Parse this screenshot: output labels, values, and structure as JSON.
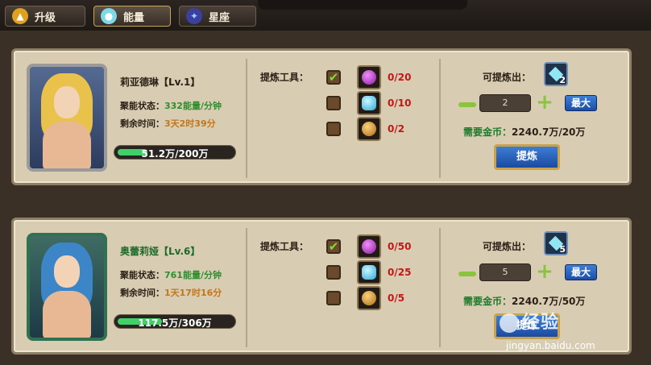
{
  "tabs": [
    {
      "label": "升级",
      "icon": "up-arrow-icon"
    },
    {
      "label": "能量",
      "icon": "potion-icon"
    },
    {
      "label": "星座",
      "icon": "constellation-icon"
    }
  ],
  "heroes": [
    {
      "name": "莉亚德琳【Lv.1】",
      "state_label": "聚能状态：",
      "state_value": "332能量/分钟",
      "time_label": "剩余时间：",
      "time_value": "3天2时39分",
      "exp_text": "51.2万/200万",
      "exp_fraction": 0.256,
      "tool_label": "提炼工具：",
      "tools": [
        {
          "checked": true,
          "count": "0/20",
          "icon": "purple-orb-icon"
        },
        {
          "checked": false,
          "count": "0/10",
          "icon": "blue-crystal-icon"
        },
        {
          "checked": false,
          "count": "0/2",
          "icon": "gold-urn-icon"
        }
      ],
      "refine_label": "可提炼出：",
      "refine_gem_count": "2",
      "stepper_value": "2",
      "max_label": "最大",
      "gold_label": "需要金币：",
      "gold_value": "2240.7万/20万",
      "refine_button": "提炼"
    },
    {
      "name": "奥蕾莉娅【Lv.6】",
      "state_label": "聚能状态：",
      "state_value": "761能量/分钟",
      "time_label": "剩余时间：",
      "time_value": "1天17时16分",
      "exp_text": "117.5万/306万",
      "exp_fraction": 0.384,
      "tool_label": "提炼工具：",
      "tools": [
        {
          "checked": true,
          "count": "0/50",
          "icon": "purple-orb-icon"
        },
        {
          "checked": false,
          "count": "0/25",
          "icon": "blue-crystal-icon"
        },
        {
          "checked": false,
          "count": "0/5",
          "icon": "gold-urn-icon"
        }
      ],
      "refine_label": "可提炼出：",
      "refine_gem_count": "5",
      "stepper_value": "5",
      "max_label": "最大",
      "gold_label": "需要金币：",
      "gold_value": "2240.7万/50万",
      "refine_button": "提炼"
    }
  ],
  "watermark": {
    "logo": "经验",
    "url": "jingyan.baidu.com"
  },
  "colors": {
    "panel": "#d8ccb3",
    "accent_blue": "#2a62bd",
    "count_red": "#c21818",
    "value_green": "#2e8f2e"
  }
}
